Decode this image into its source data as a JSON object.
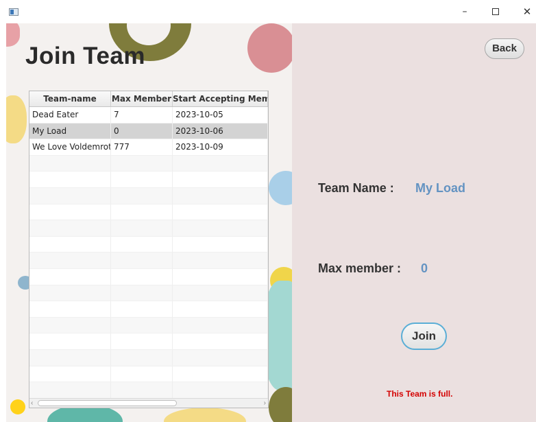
{
  "window": {
    "minimize_glyph": "–",
    "close_glyph": "✕"
  },
  "page": {
    "title": "Join Team",
    "back_label": "Back"
  },
  "table": {
    "columns": [
      "Team-name",
      "Max Member",
      "Start Accepting Member"
    ],
    "rows": [
      [
        "Dead Eater",
        "7",
        "2023-10-05"
      ],
      [
        "My Load",
        "0",
        "2023-10-06"
      ],
      [
        "We Love Voldemrot",
        "777",
        "2023-10-09"
      ]
    ],
    "selected_row": 1,
    "scroll_left_glyph": "‹",
    "scroll_right_glyph": "›"
  },
  "details": {
    "team_name_label": "Team Name :",
    "team_name_value": "My Load",
    "max_member_label": "Max member :",
    "max_member_value": "0",
    "join_label": "Join",
    "status_message": "This Team is full."
  },
  "colors": {
    "accent_value": "#6393c2",
    "join_border": "#5aaed6",
    "status": "#d40000"
  }
}
